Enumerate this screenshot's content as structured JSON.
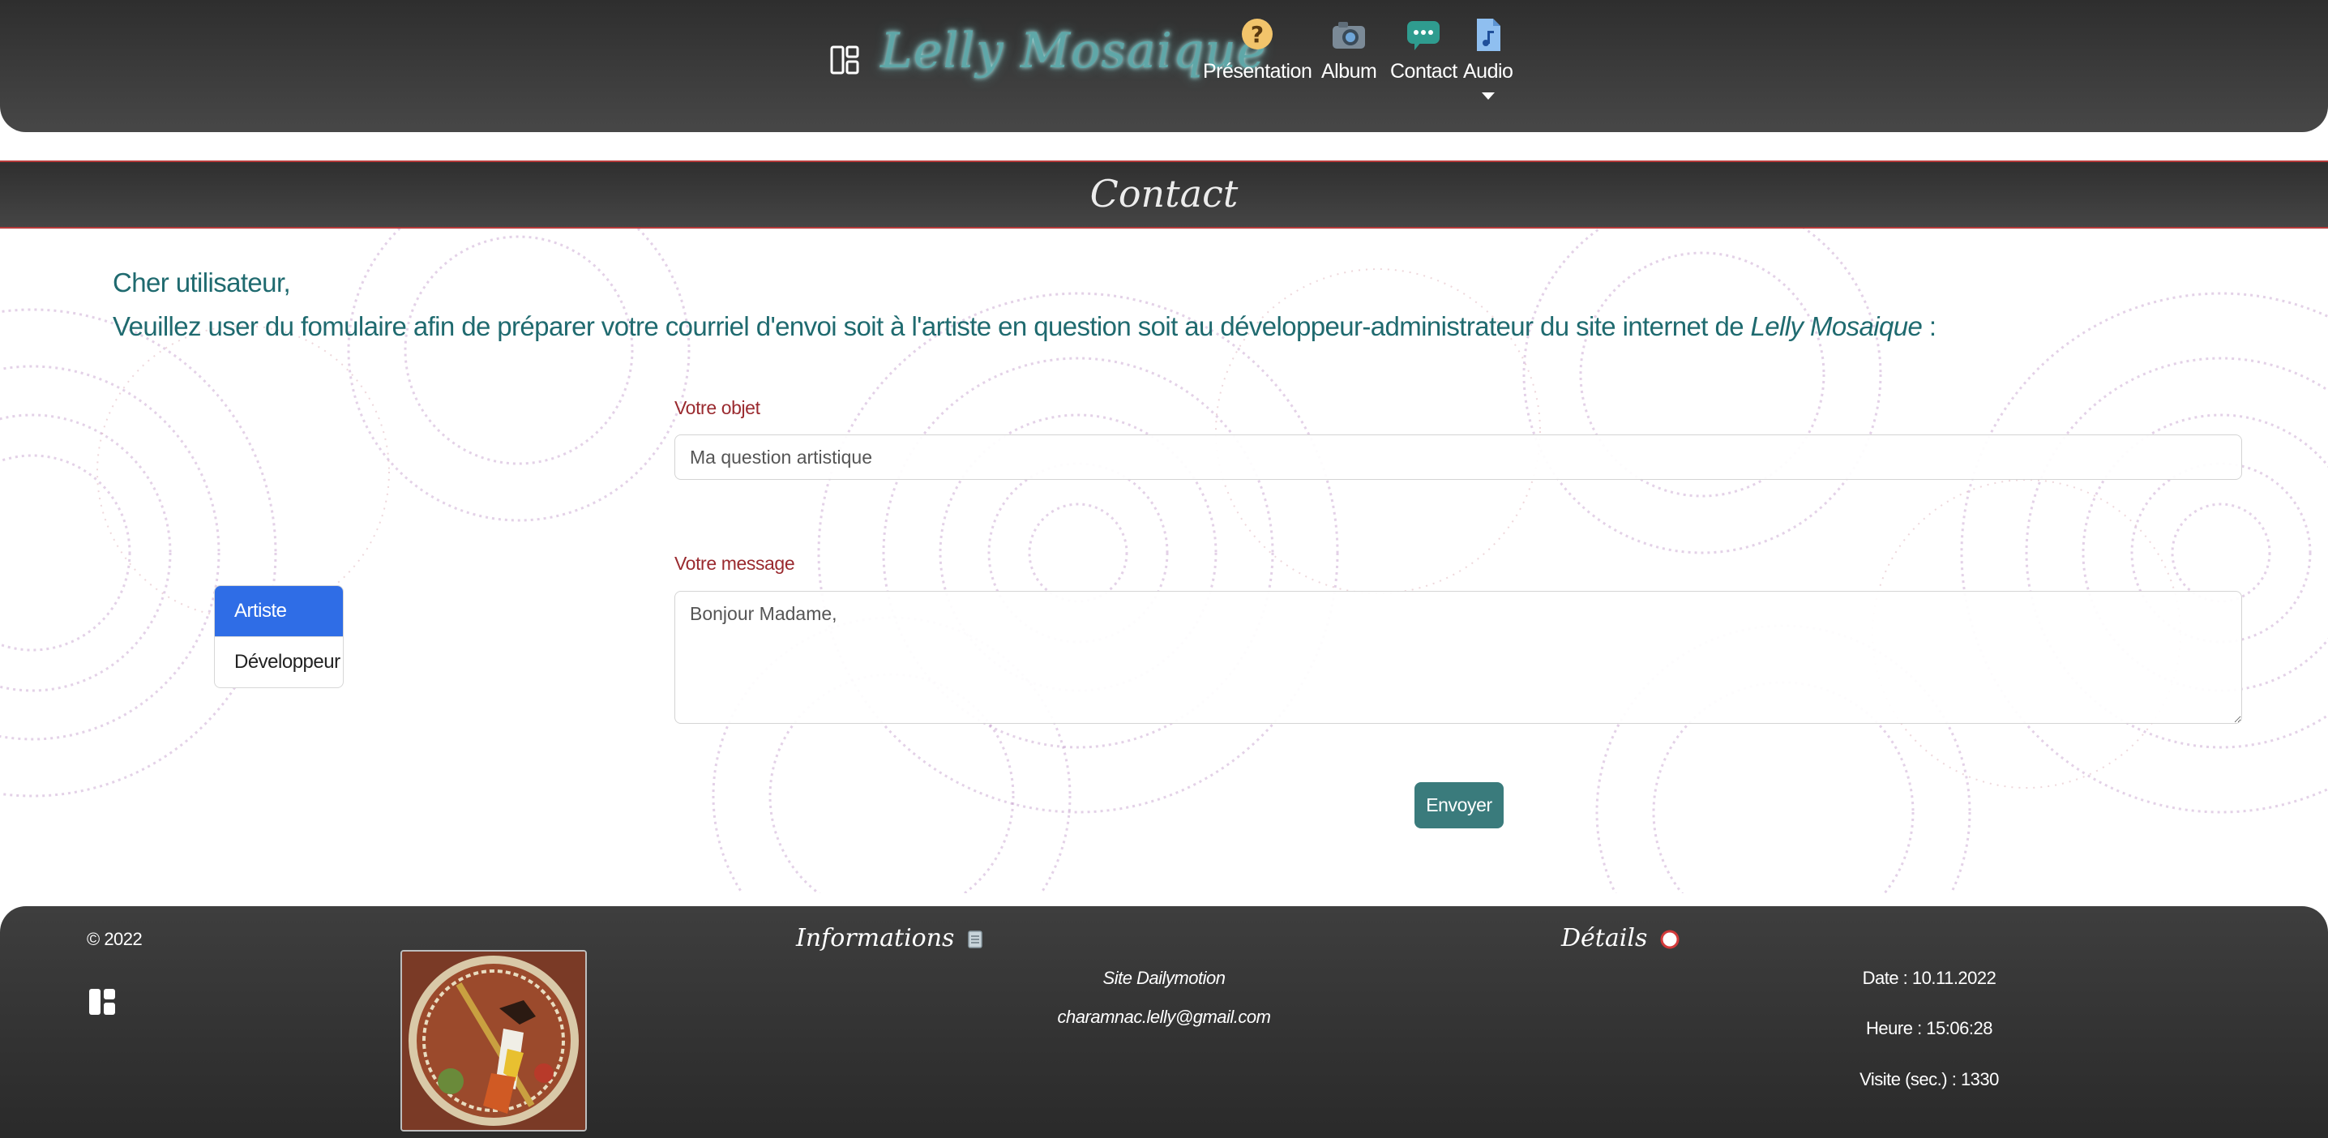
{
  "header": {
    "brand": "Lelly Mosaique",
    "nav": [
      {
        "label": "Présentation",
        "icon": "question-face-icon"
      },
      {
        "label": "Album",
        "icon": "camera-icon"
      },
      {
        "label": "Contact",
        "icon": "chat-bubble-icon"
      },
      {
        "label": "Audio",
        "icon": "music-file-icon"
      }
    ]
  },
  "page": {
    "title": "Contact",
    "greeting": "Cher utilisateur,",
    "instruction": "Veuillez user du fomulaire afin de préparer votre courriel d'envoi soit à l'artiste en question soit au développeur-administrateur du site internet de ",
    "instruction_site": "Lelly Mosaique",
    "instruction_end": " :"
  },
  "recipients": {
    "items": [
      "Artiste",
      "Développeur"
    ],
    "selected": "Artiste"
  },
  "form": {
    "subject_label": "Votre objet",
    "subject_value": "Ma question artistique",
    "message_label": "Votre message",
    "message_value": "Bonjour Madame,",
    "send_label": "Envoyer"
  },
  "footer": {
    "copyright": "© 2022",
    "informations_title": "Informations",
    "info_link": "Site Dailymotion",
    "email": "charamnac.lelly@gmail.com",
    "details_title": "Détails",
    "date": "Date : 10.11.2022",
    "heure": "Heure : 15:06:28",
    "visite": "Visite (sec.) : 1330"
  },
  "colors": {
    "accent": "#3a7b7c",
    "active_tab": "#2f6de6",
    "label_red": "#9a2a2f",
    "intro_teal": "#1f6a6f"
  }
}
